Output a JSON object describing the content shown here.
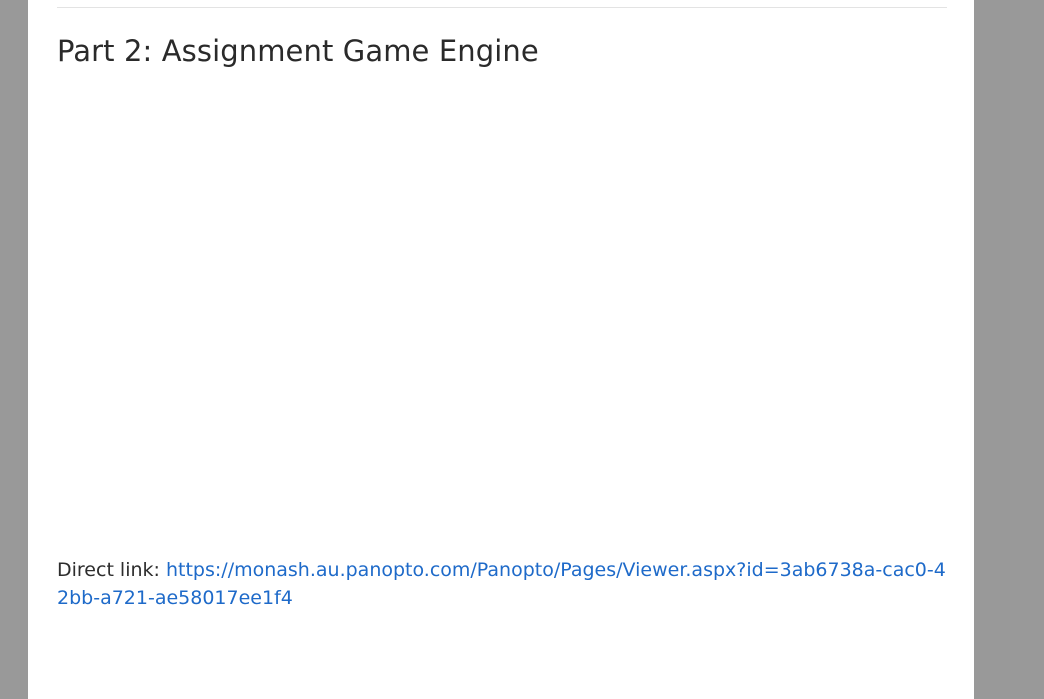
{
  "section": {
    "title": "Part 2: Assignment Game Engine"
  },
  "direct_link": {
    "label": "Direct link:",
    "url_text": "https://monash.au.panopto.com/Panopto/Pages/Viewer.aspx?id=3ab6738a-cac0-42bb-a721-ae58017ee1f4",
    "href": "https://monash.au.panopto.com/Panopto/Pages/Viewer.aspx?id=3ab6738a-cac0-42bb-a721-ae58017ee1f4"
  },
  "colors": {
    "backdrop": "#999999",
    "page": "#ffffff",
    "link": "#1e6ac9",
    "text": "#2d2d2d"
  }
}
